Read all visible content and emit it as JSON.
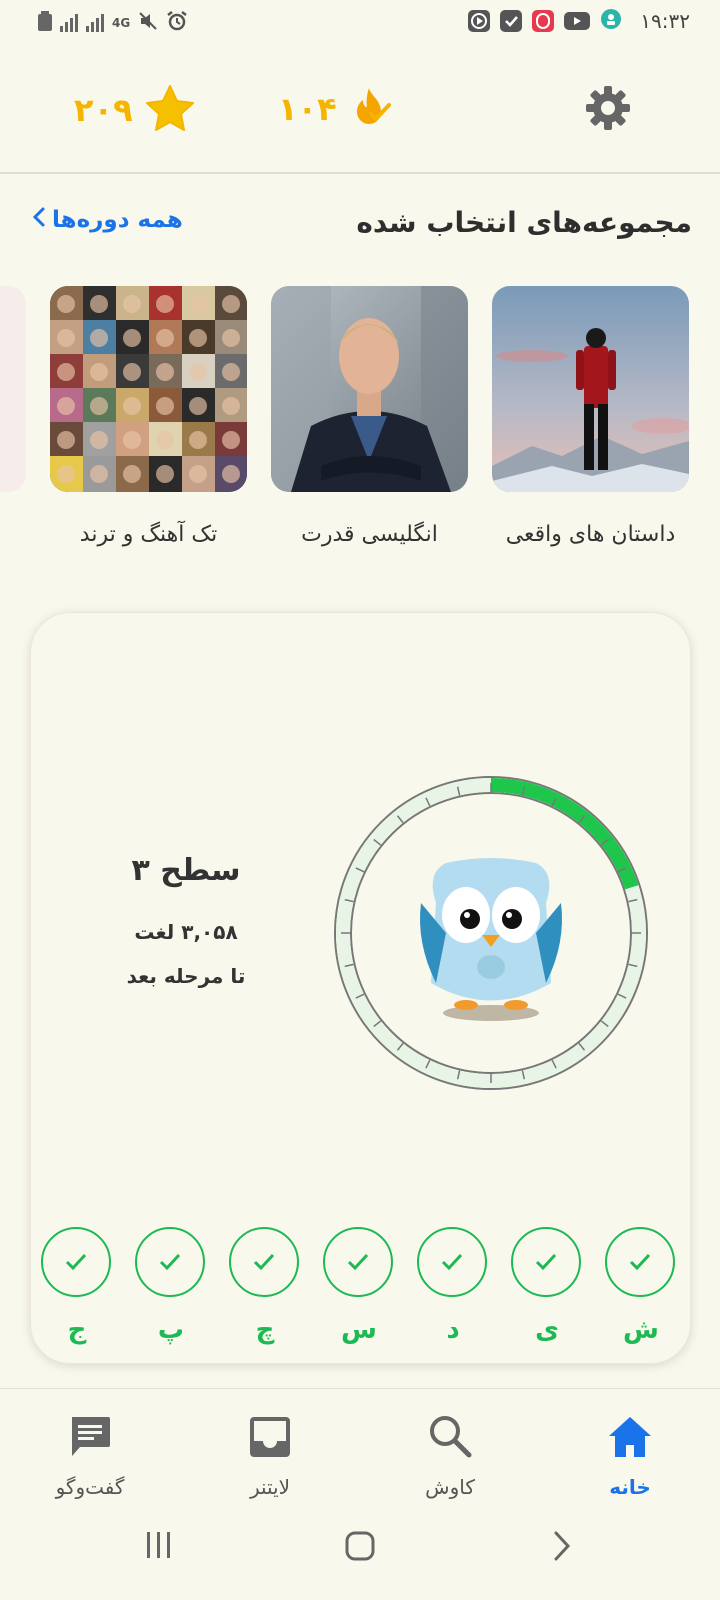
{
  "status_bar": {
    "time": "۱۹:۳۲",
    "network": "4G"
  },
  "header": {
    "stars_count": "۲۰۹",
    "streak_count": "۱۰۴",
    "icons": [
      "star-icon",
      "streak-fire-icon",
      "gear-icon"
    ]
  },
  "featured": {
    "title": "مجموعه‌های انتخاب شده",
    "all_courses_label": "همه دوره‌ها",
    "cards": [
      {
        "label": "داستان های واقعی"
      },
      {
        "label": "انگلیسی قدرت"
      },
      {
        "label": "تک آهنگ و ترند"
      }
    ]
  },
  "level": {
    "title": "سطح ۳",
    "words": "۳,۰۵۸ لغت",
    "next": "تا مرحله بعد",
    "progress_fraction": 0.2,
    "letters": [
      "ش",
      "ی",
      "د",
      "س",
      "چ",
      "پ",
      "ج"
    ]
  },
  "bottom_nav": {
    "items": [
      {
        "label": "خانه",
        "icon": "home-icon",
        "active": true
      },
      {
        "label": "کاوش",
        "icon": "search-icon",
        "active": false
      },
      {
        "label": "لایتنر",
        "icon": "inbox-icon",
        "active": false
      },
      {
        "label": "گفت‌وگو",
        "icon": "chat-icon",
        "active": false
      }
    ]
  },
  "colors": {
    "background": "#f9f8ec",
    "accent_blue": "#1a73e8",
    "accent_green": "#1db954",
    "gold": "#f5b400"
  }
}
